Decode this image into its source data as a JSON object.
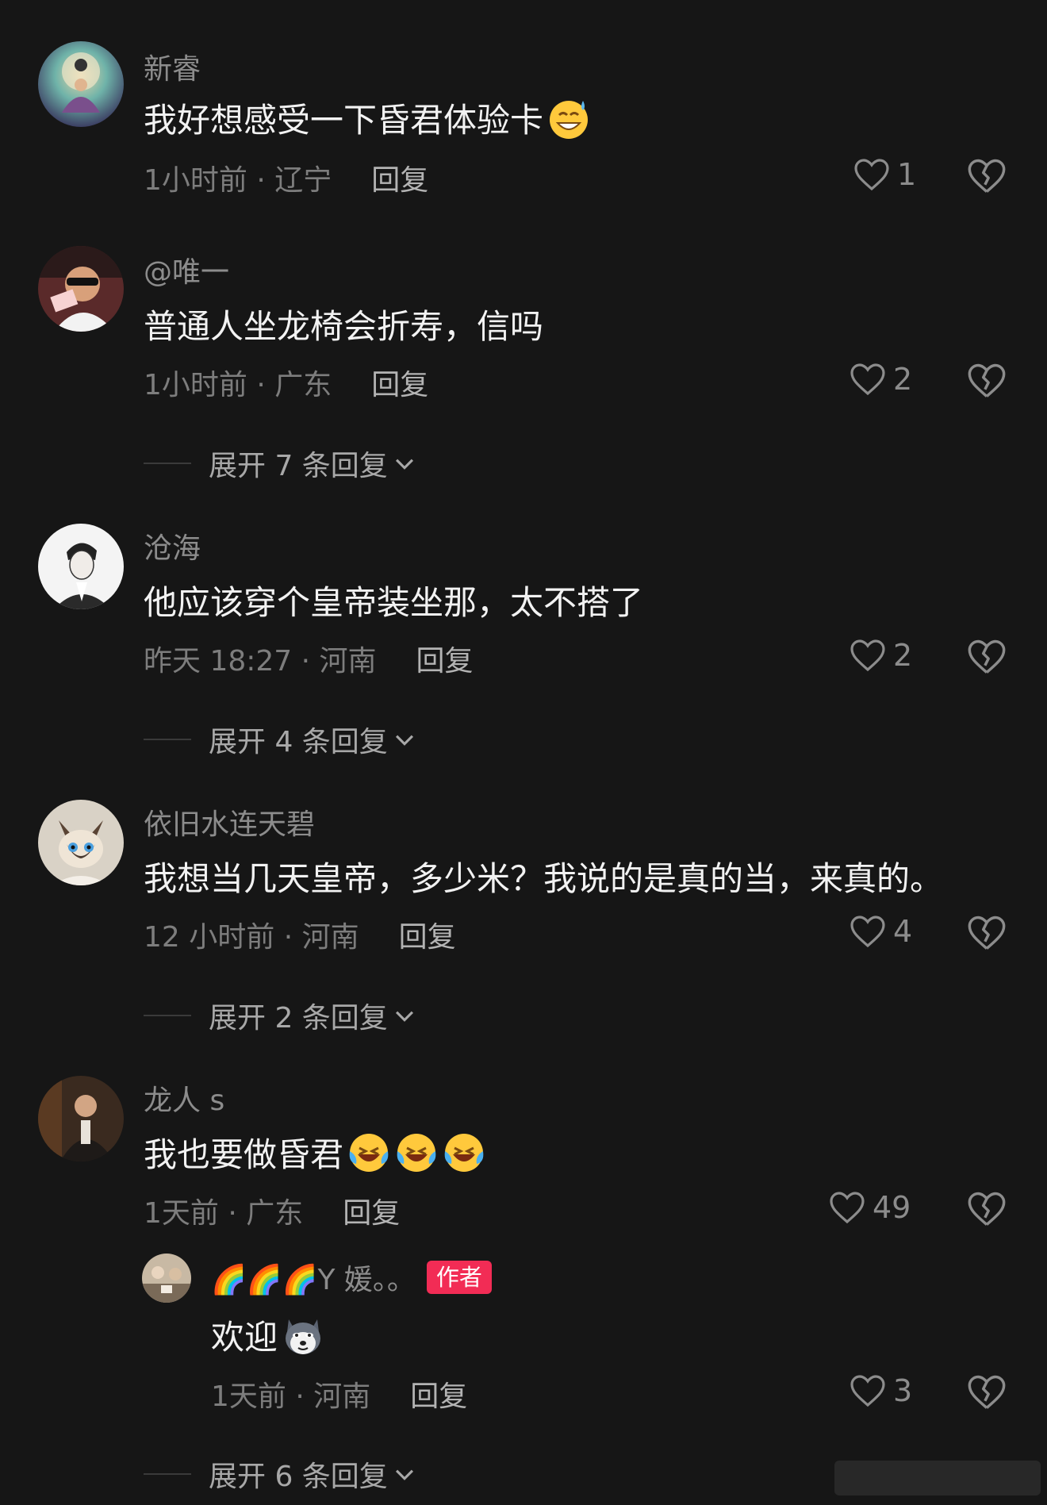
{
  "colors": {
    "background": "#161616",
    "username": "#8c8c8c",
    "text": "#f2f2f2",
    "meta": "#7d7d7d",
    "author_tag": "#f22c55"
  },
  "comments": [
    {
      "username": "新睿",
      "text": "我好想感受一下昏君体验卡",
      "emoji": "grinning-sweat-emoji",
      "time_location": "1小时前 · 辽宁",
      "reply_label": "回复",
      "likes": "1"
    },
    {
      "username": "@唯一",
      "text": "普通人坐龙椅会折寿，信吗",
      "time_location": "1小时前 · 广东",
      "reply_label": "回复",
      "likes": "2",
      "expand_label": "展开 7 条回复"
    },
    {
      "username": "沧海",
      "text": "他应该穿个皇帝装坐那，太不搭了",
      "time_location": "昨天 18:27 · 河南",
      "reply_label": "回复",
      "likes": "2",
      "expand_label": "展开 4 条回复"
    },
    {
      "username": "依旧水连天碧",
      "text": "我想当几天皇帝，多少米？我说的是真的当，来真的。",
      "time_location": "12 小时前 · 河南",
      "reply_label": "回复",
      "likes": "4",
      "expand_label": "展开 2 条回复"
    },
    {
      "username": "龙人 s",
      "text": "我也要做昏君",
      "emoji": "crying-laughing-emoji",
      "time_location": "1天前 · 广东",
      "reply_label": "回复",
      "likes": "49",
      "reply": {
        "username": "🌈🌈🌈Y 媛。。",
        "author_tag": "作者",
        "text": "欢迎",
        "emoji": "husky-dog-emoji",
        "time_location": "1天前 · 河南",
        "reply_label": "回复",
        "likes": "3"
      },
      "expand_label": "展开 6 条回复"
    }
  ]
}
